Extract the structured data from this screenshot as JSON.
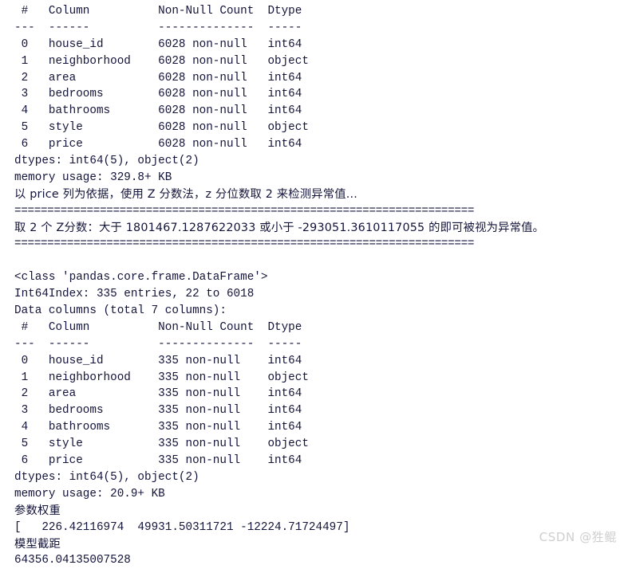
{
  "terminal": {
    "background_color": "#ffffff",
    "text_color": "#13143a",
    "lines": [
      " #   Column          Non-Null Count  Dtype ",
      "---  ------          --------------  ----- ",
      " 0   house_id        6028 non-null   int64 ",
      " 1   neighborhood    6028 non-null   object",
      " 2   area            6028 non-null   int64 ",
      " 3   bedrooms        6028 non-null   int64 ",
      " 4   bathrooms       6028 non-null   int64 ",
      " 5   style           6028 non-null   object",
      " 6   price           6028 non-null   int64 ",
      "dtypes: int64(5), object(2)",
      "memory usage: 329.8+ KB",
      "以 price 列为依据，使用 Z 分数法，z 分位数取 2 来检测异常值...",
      "======================================================================",
      "取 2 个 Z分数：大于 1801467.1287622033 或小于 -293051.3610117055 的即可被视为异常值。",
      "======================================================================",
      "",
      "<class 'pandas.core.frame.DataFrame'>",
      "Int64Index: 335 entries, 22 to 6018",
      "Data columns (total 7 columns):",
      " #   Column          Non-Null Count  Dtype ",
      "---  ------          --------------  ----- ",
      " 0   house_id        335 non-null    int64 ",
      " 1   neighborhood    335 non-null    object",
      " 2   area            335 non-null    int64 ",
      " 3   bedrooms        335 non-null    int64 ",
      " 4   bathrooms       335 non-null    int64 ",
      " 5   style           335 non-null    object",
      " 6   price           335 non-null    int64 ",
      "dtypes: int64(5), object(2)",
      "memory usage: 20.9+ KB",
      "参数权重",
      "[   226.42116974  49931.50311721 -12224.71724497]",
      "模型截距",
      "64356.04135007528"
    ],
    "line_kinds": [
      "ascii",
      "ascii",
      "ascii",
      "ascii",
      "ascii",
      "ascii",
      "ascii",
      "ascii",
      "ascii",
      "ascii",
      "ascii",
      "cjk",
      "sep",
      "cjk",
      "sep",
      "blank",
      "ascii",
      "ascii",
      "ascii",
      "ascii",
      "ascii",
      "ascii",
      "ascii",
      "ascii",
      "ascii",
      "ascii",
      "ascii",
      "ascii",
      "ascii",
      "ascii",
      "cjk",
      "ascii",
      "cjk",
      "ascii"
    ]
  },
  "watermark": {
    "text": "CSDN @狌鲲",
    "color": "#cfcfcf"
  }
}
